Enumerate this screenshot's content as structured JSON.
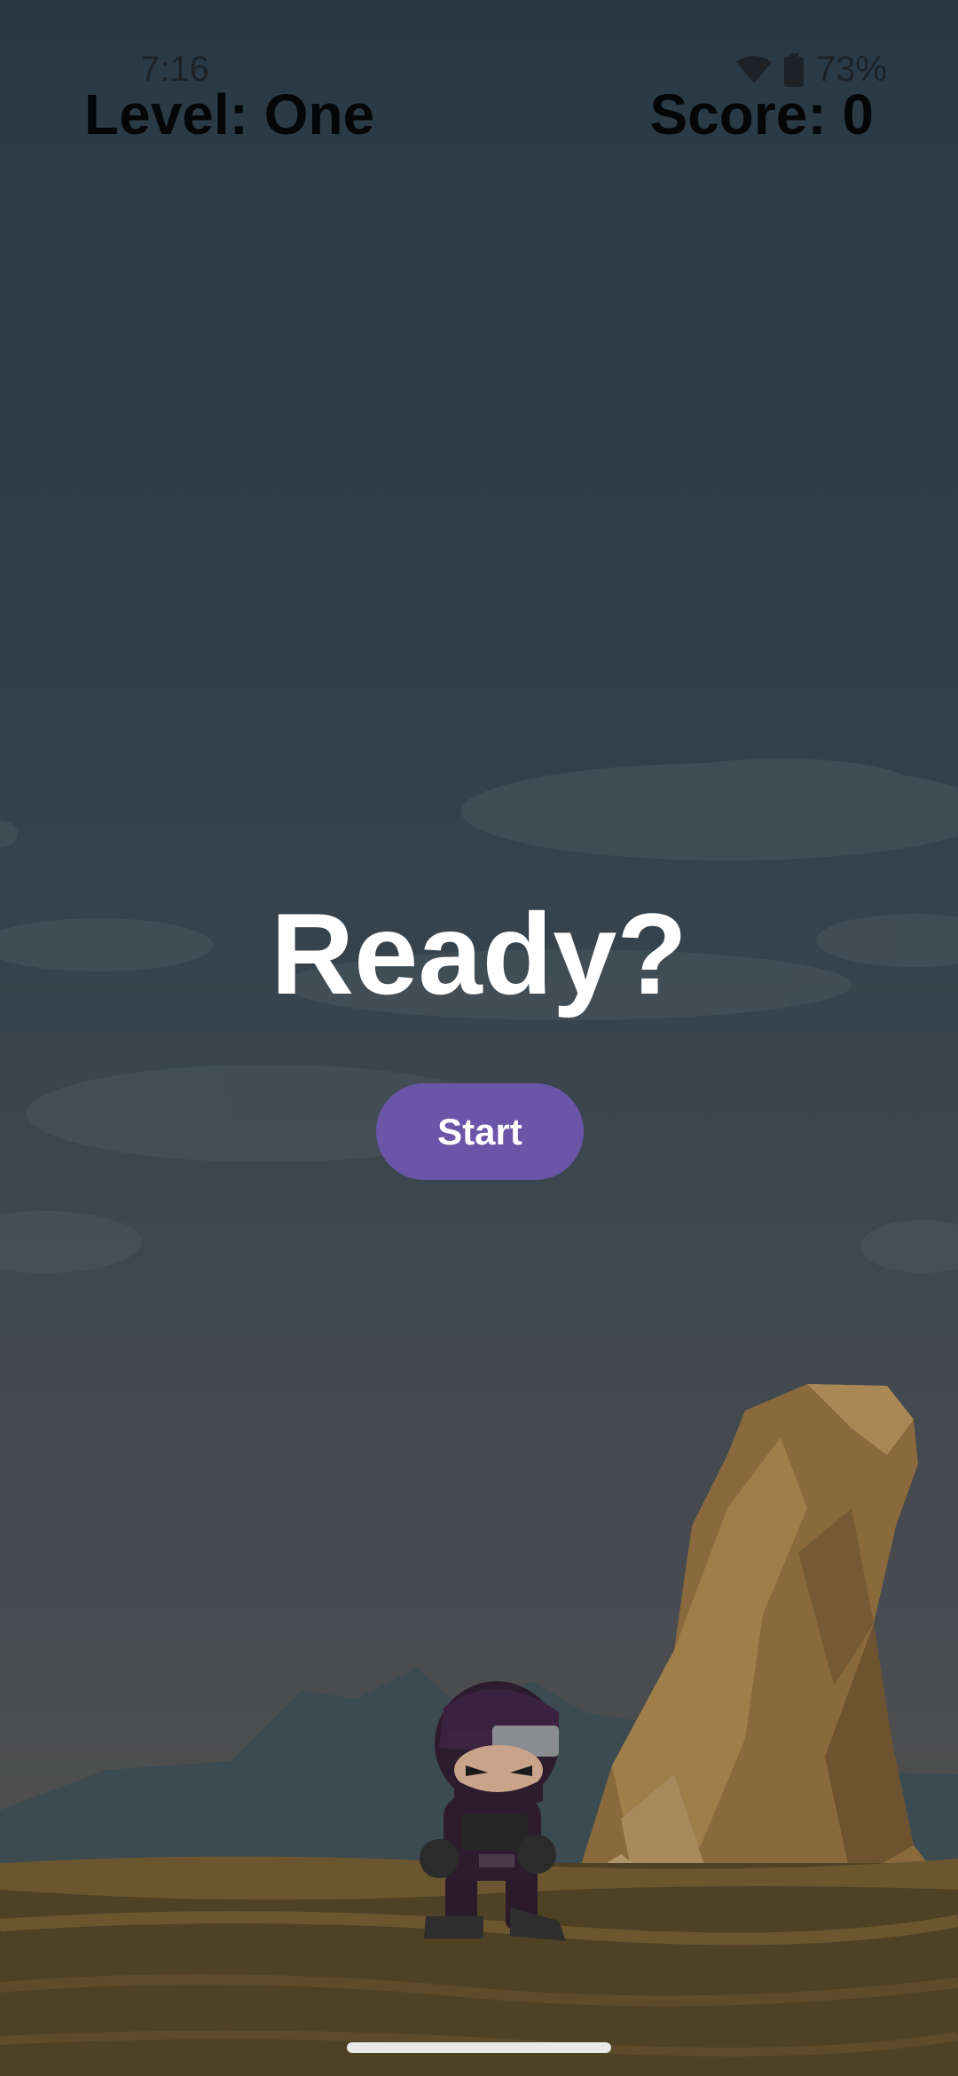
{
  "status_bar": {
    "time": "7:16",
    "battery_percent": "73%",
    "icons": [
      "wifi-icon",
      "battery-icon"
    ],
    "text_color": "#1d2227"
  },
  "hud": {
    "level_text": "Level: One",
    "score_text": "Score: 0"
  },
  "overlay": {
    "title": "Ready?",
    "start_label": "Start",
    "button_color": "#6a55a8"
  },
  "scene": {
    "character": "ninja-character",
    "elements": [
      "cloud",
      "rock-pillar",
      "sand-ground",
      "mountains"
    ]
  }
}
